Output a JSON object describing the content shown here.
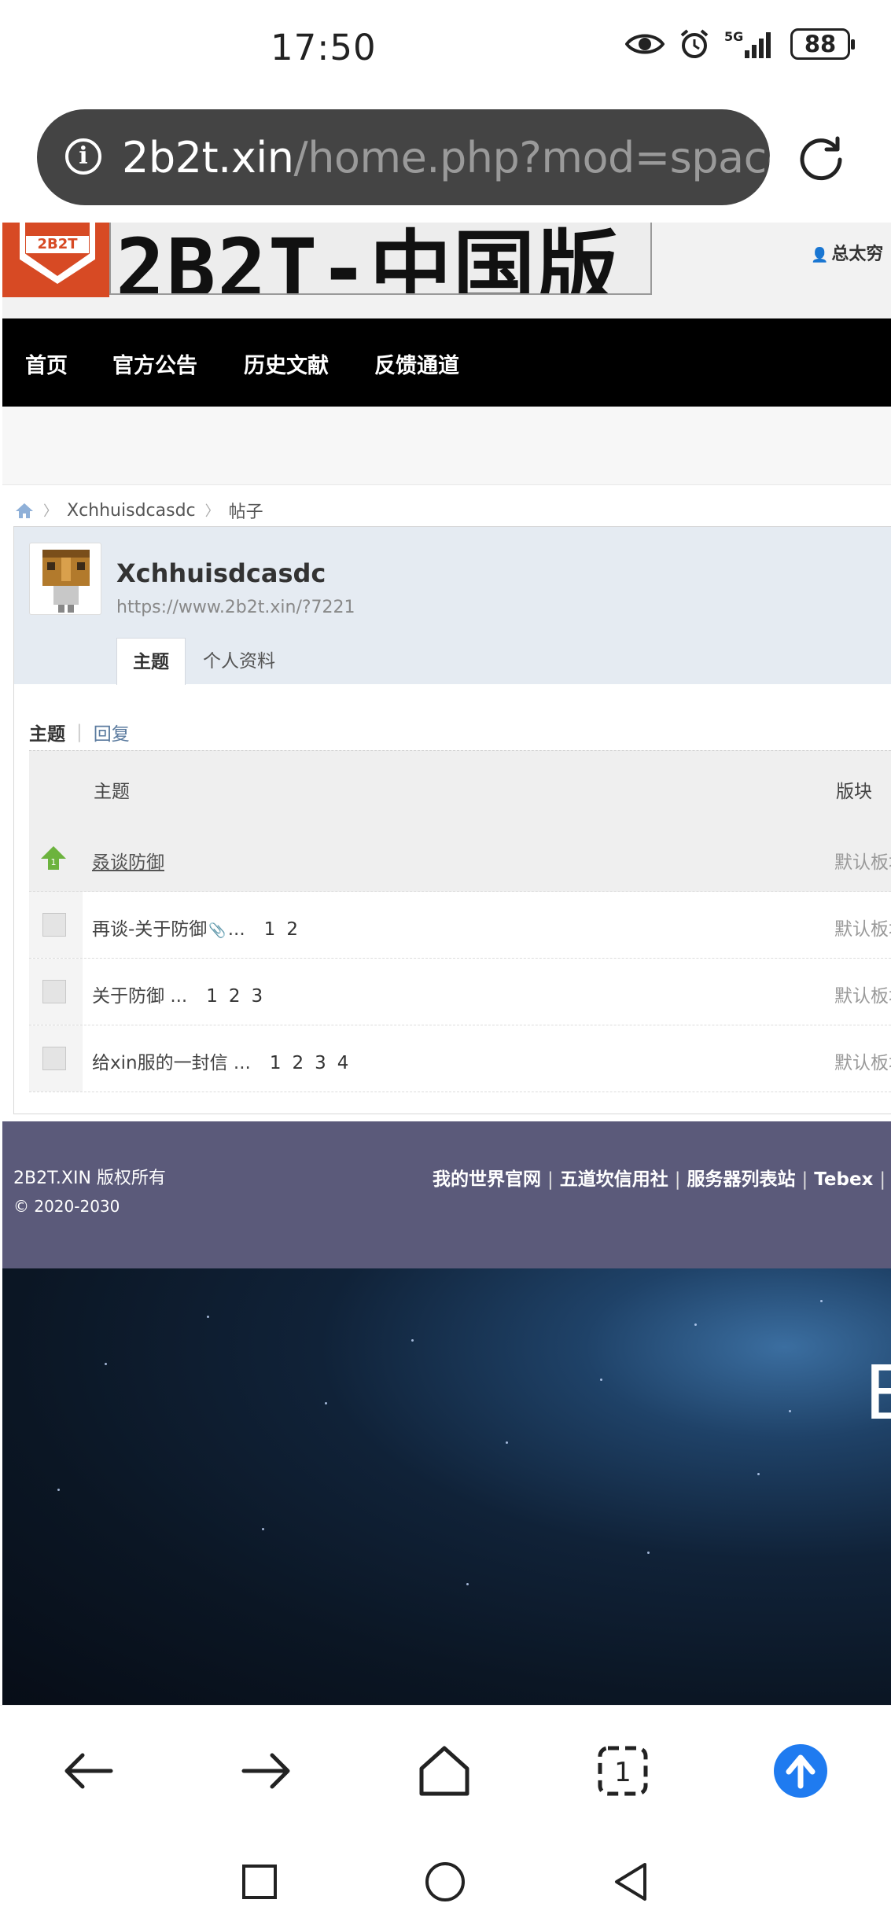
{
  "status_bar": {
    "time": "17:50",
    "battery": "88",
    "signal": "5G",
    "icons": [
      "eye-icon",
      "alarm-icon",
      "signal-icon",
      "battery-icon"
    ]
  },
  "browser": {
    "url_host": "2b2t.xin",
    "url_path": "/home.php?mod=space&",
    "info_glyph": "i"
  },
  "site": {
    "logo_tag": "2B2T",
    "logo_title": "2B2T-中国版",
    "user_link": "总太穷",
    "nav": [
      "首页",
      "官方公告",
      "历史文献",
      "反馈通道"
    ]
  },
  "breadcrumb": {
    "user": "Xchhuisdcasdc",
    "section": "帖子"
  },
  "profile": {
    "name": "Xchhuisdcasdc",
    "url": "https://www.2b2t.xin/?7221",
    "tabs": [
      "主题",
      "个人资料"
    ]
  },
  "subtabs": {
    "active": "主题",
    "other": "回复"
  },
  "table": {
    "header_topic": "主题",
    "header_forum": "版块",
    "rows": [
      {
        "title": "叒谈防御",
        "pages": [],
        "forum": "默认板块",
        "hot": true
      },
      {
        "title": "再谈-关于防御",
        "pages": [
          "1",
          "2"
        ],
        "forum": "默认板块",
        "hot": false,
        "attachment": true
      },
      {
        "title": "关于防御",
        "pages": [
          "1",
          "2",
          "3"
        ],
        "forum": "默认板块",
        "hot": false
      },
      {
        "title": "给xin服的一封信",
        "pages": [
          "1",
          "2",
          "3",
          "4"
        ],
        "forum": "默认板块",
        "hot": false
      }
    ],
    "ellipsis": "..."
  },
  "footer": {
    "copyright": "2B2T.XIN 版权所有",
    "years": "© 2020-2030",
    "links": [
      "我的世界官网",
      "五道坎信用社",
      "服务器列表站",
      "Tebex"
    ]
  },
  "space_letter": "E",
  "bottom_bar": {
    "tab_count": "1"
  },
  "colors": {
    "nav_bg": "#000000",
    "footer_bg": "#5b5a7a",
    "profile_bg": "#e5ebf2",
    "accent_blue": "#1f7bf0",
    "logo_red": "#d74a24"
  }
}
